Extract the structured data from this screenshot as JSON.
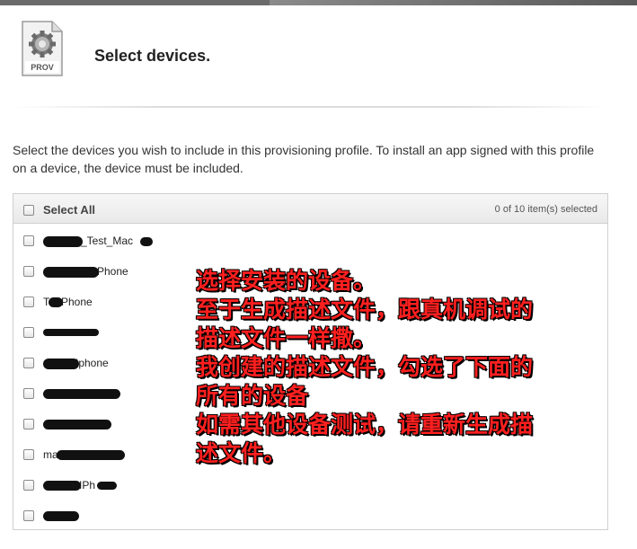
{
  "page": {
    "title": "Select devices.",
    "icon_label": "PROV",
    "description": "Select the devices you wish to include in this provisioning profile. To install an app signed with this profile on a device, the device must be included."
  },
  "device_panel": {
    "select_all_label": "Select All",
    "selected_count": "0 of 10 item(s) selected",
    "devices": [
      {
        "label": "_Test_Mac",
        "checked": false
      },
      {
        "label": "Phone",
        "checked": false
      },
      {
        "label": "Phone",
        "checked": false
      },
      {
        "label": "",
        "checked": false
      },
      {
        "label": "Iphone",
        "checked": false
      },
      {
        "label": "",
        "checked": false
      },
      {
        "label": "",
        "checked": false
      },
      {
        "label": "ma",
        "checked": false
      },
      {
        "label": "IPh",
        "checked": false
      },
      {
        "label": "",
        "checked": false
      }
    ]
  },
  "annotation": {
    "lines": [
      "选择安装的设备。",
      "至于生成描述文件，跟真机调试的",
      "描述文件一样撒。",
      "我创建的描述文件，勾选了下面的",
      "所有的设备",
      "如需其他设备测试，请重新生成描",
      "述文件。"
    ],
    "color": "#ff1f1f"
  }
}
